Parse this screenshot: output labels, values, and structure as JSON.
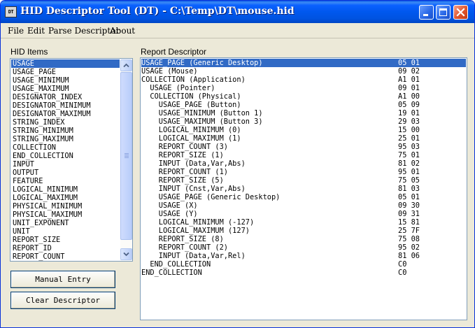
{
  "window": {
    "title": "HID Descriptor Tool (DT) - C:\\Temp\\DT\\mouse.hid",
    "icon_text": "DT"
  },
  "menu": {
    "items": [
      "File",
      "Edit",
      "Parse Descriptor",
      "About"
    ]
  },
  "hid_items": {
    "label": "HID Items",
    "selected_index": 0,
    "items": [
      "USAGE",
      "USAGE_PAGE",
      "USAGE_MINIMUM",
      "USAGE_MAXIMUM",
      "DESIGNATOR_INDEX",
      "DESIGNATOR_MINIMUM",
      "DESIGNATOR_MAXIMUM",
      "STRING_INDEX",
      "STRING_MINIMUM",
      "STRING_MAXIMUM",
      "COLLECTION",
      "END_COLLECTION",
      "INPUT",
      "OUTPUT",
      "FEATURE",
      "LOGICAL_MINIMUM",
      "LOGICAL_MAXIMUM",
      "PHYSICAL_MINIMUM",
      "PHYSICAL_MAXIMUM",
      "UNIT_EXPONENT",
      "UNIT",
      "REPORT_SIZE",
      "REPORT_ID",
      "REPORT_COUNT"
    ]
  },
  "buttons": {
    "manual_entry": "Manual Entry",
    "clear_descriptor": "Clear Descriptor"
  },
  "report_descriptor": {
    "label": "Report Descriptor",
    "selected_index": 0,
    "rows": [
      {
        "text": "USAGE_PAGE (Generic Desktop)",
        "bytes": "05 01"
      },
      {
        "text": "USAGE (Mouse)",
        "bytes": "09 02"
      },
      {
        "text": "COLLECTION (Application)",
        "bytes": "A1 01"
      },
      {
        "text": "  USAGE (Pointer)",
        "bytes": "09 01"
      },
      {
        "text": "  COLLECTION (Physical)",
        "bytes": "A1 00"
      },
      {
        "text": "    USAGE_PAGE (Button)",
        "bytes": "05 09"
      },
      {
        "text": "    USAGE_MINIMUM (Button 1)",
        "bytes": "19 01"
      },
      {
        "text": "    USAGE_MAXIMUM (Button 3)",
        "bytes": "29 03"
      },
      {
        "text": "    LOGICAL_MINIMUM (0)",
        "bytes": "15 00"
      },
      {
        "text": "    LOGICAL_MAXIMUM (1)",
        "bytes": "25 01"
      },
      {
        "text": "    REPORT_COUNT (3)",
        "bytes": "95 03"
      },
      {
        "text": "    REPORT_SIZE (1)",
        "bytes": "75 01"
      },
      {
        "text": "    INPUT (Data,Var,Abs)",
        "bytes": "81 02"
      },
      {
        "text": "    REPORT_COUNT (1)",
        "bytes": "95 01"
      },
      {
        "text": "    REPORT_SIZE (5)",
        "bytes": "75 05"
      },
      {
        "text": "    INPUT (Cnst,Var,Abs)",
        "bytes": "81 03"
      },
      {
        "text": "    USAGE_PAGE (Generic Desktop)",
        "bytes": "05 01"
      },
      {
        "text": "    USAGE (X)",
        "bytes": "09 30"
      },
      {
        "text": "    USAGE (Y)",
        "bytes": "09 31"
      },
      {
        "text": "    LOGICAL_MINIMUM (-127)",
        "bytes": "15 81"
      },
      {
        "text": "    LOGICAL_MAXIMUM (127)",
        "bytes": "25 7F"
      },
      {
        "text": "    REPORT_SIZE (8)",
        "bytes": "75 08"
      },
      {
        "text": "    REPORT_COUNT (2)",
        "bytes": "95 02"
      },
      {
        "text": "    INPUT (Data,Var,Rel)",
        "bytes": "81 06"
      },
      {
        "text": "  END_COLLECTION",
        "bytes": "C0"
      },
      {
        "text": "END_COLLECTION",
        "bytes": "C0"
      }
    ]
  },
  "colors": {
    "selection": "#316ac5",
    "titlebar": "#0058ee",
    "window_bg": "#ece9d8"
  }
}
